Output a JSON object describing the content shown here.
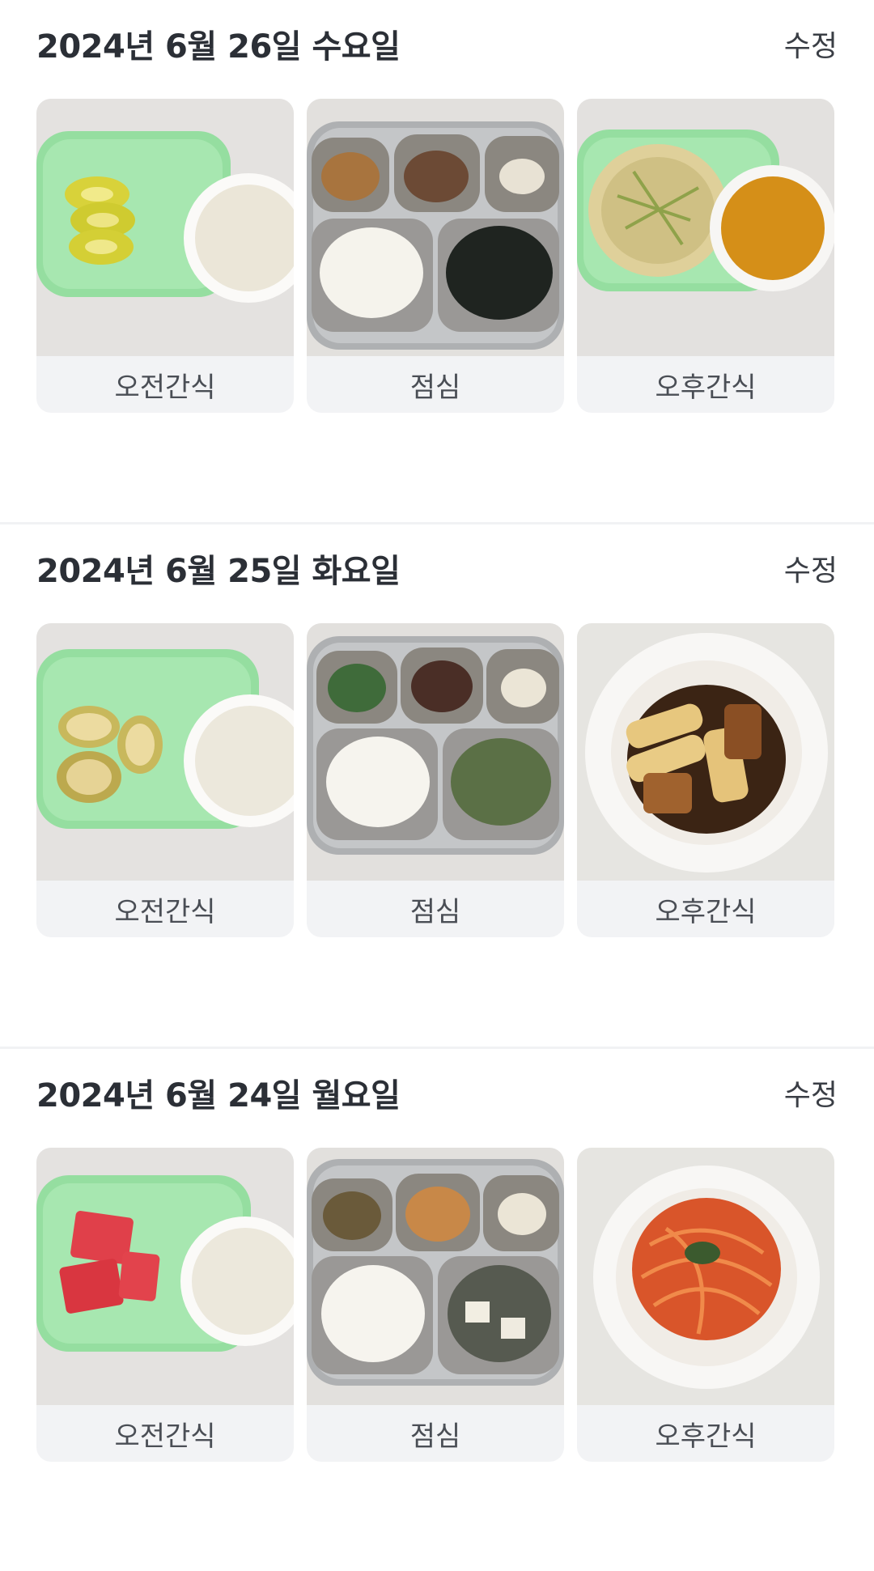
{
  "entries": [
    {
      "date": "2024년 6월 26일 수요일",
      "edit_label": "수정",
      "meals": [
        {
          "label": "오전간식",
          "photo": "kiwi-and-milk"
        },
        {
          "label": "점심",
          "photo": "rice-lunch-tray"
        },
        {
          "label": "오후간식",
          "photo": "pancake-and-juice"
        }
      ]
    },
    {
      "date": "2024년 6월 25일 화요일",
      "edit_label": "수정",
      "meals": [
        {
          "label": "오전간식",
          "photo": "banana-and-milk"
        },
        {
          "label": "점심",
          "photo": "rice-lunch-tray"
        },
        {
          "label": "오후간식",
          "photo": "tteokbokki-bowl"
        }
      ]
    },
    {
      "date": "2024년 6월 24일 월요일",
      "edit_label": "수정",
      "meals": [
        {
          "label": "오전간식",
          "photo": "watermelon-and-milk"
        },
        {
          "label": "점심",
          "photo": "rice-lunch-tray"
        },
        {
          "label": "오후간식",
          "photo": "spaghetti-bowl"
        }
      ]
    }
  ]
}
